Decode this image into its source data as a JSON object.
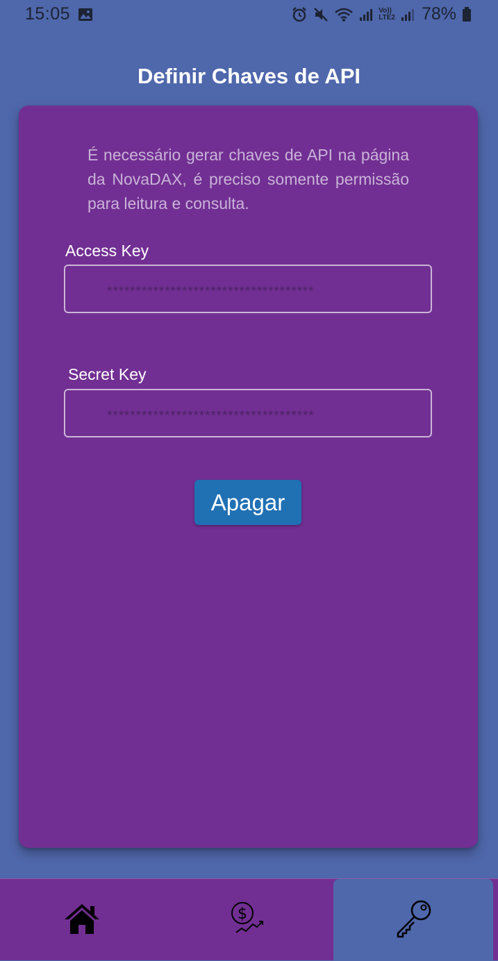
{
  "status_bar": {
    "time": "15:05",
    "battery": "78%",
    "icons": [
      "image-icon",
      "alarm-icon",
      "mute-icon",
      "wifi-icon",
      "signal-icon",
      "volte-icon",
      "signal-icon",
      "battery-icon"
    ],
    "volte_label_top": "Vo))",
    "volte_label_bottom": "LTE2"
  },
  "page": {
    "title": "Definir Chaves de API"
  },
  "card": {
    "intro": "É necessário gerar chaves de API na página da NovaDAX, é preciso somente permissão para leitura e consulta.",
    "access_key": {
      "label": "Access Key",
      "value": "************************************"
    },
    "secret_key": {
      "label": "Secret Key",
      "value": "************************************"
    },
    "delete_label": "Apagar"
  },
  "bottom_nav": {
    "items": [
      {
        "icon": "home-icon",
        "active": false
      },
      {
        "icon": "investment-icon",
        "active": false
      },
      {
        "icon": "key-icon",
        "active": true
      }
    ]
  },
  "colors": {
    "background": "#4f67ab",
    "card": "#722f93",
    "button": "#2070b4",
    "text": "#ffffff"
  }
}
